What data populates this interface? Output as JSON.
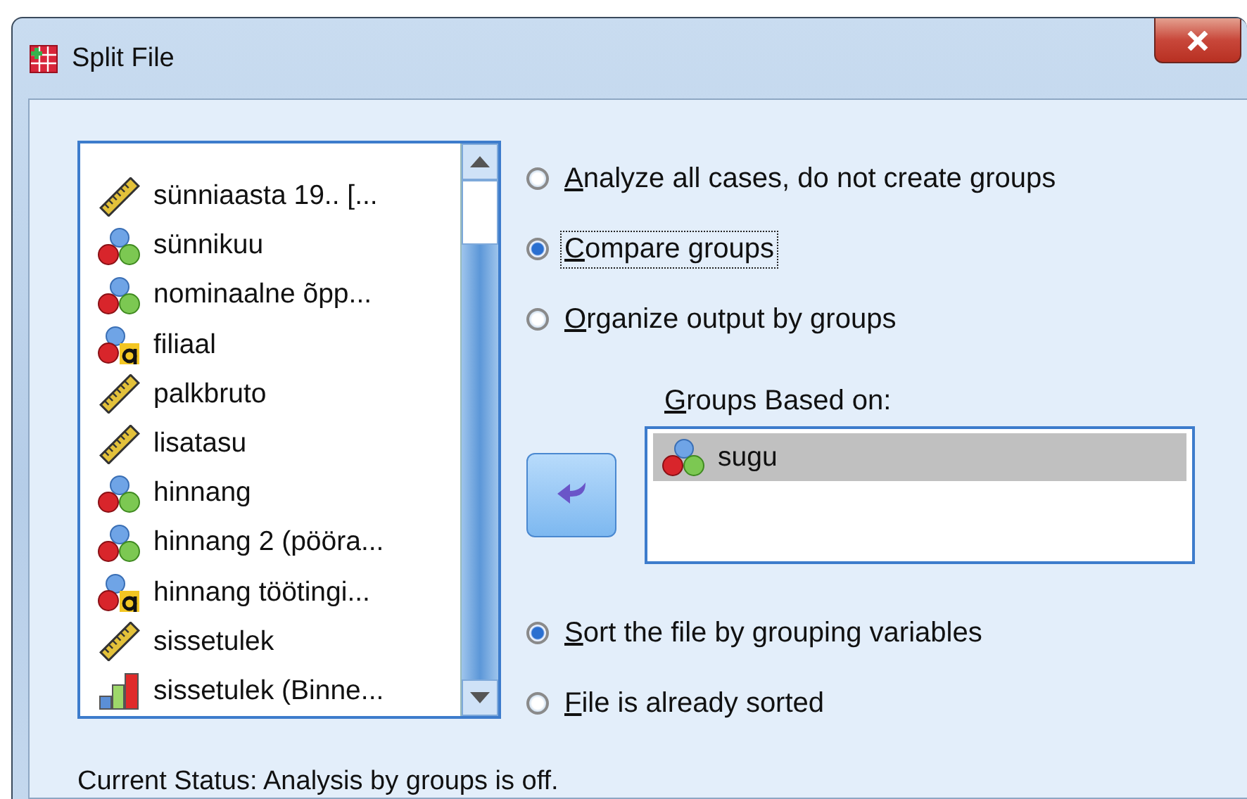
{
  "window": {
    "title": "Split File"
  },
  "variables": [
    {
      "name": "sünniaasta 19.. [...",
      "kind": "scale"
    },
    {
      "name": "sünnikuu",
      "kind": "nominal"
    },
    {
      "name": "nominaalne õpp...",
      "kind": "nominal"
    },
    {
      "name": "filiaal",
      "kind": "string"
    },
    {
      "name": "palkbruto",
      "kind": "scale"
    },
    {
      "name": "lisatasu",
      "kind": "scale"
    },
    {
      "name": "hinnang",
      "kind": "nominal"
    },
    {
      "name": "hinnang 2 (pööra...",
      "kind": "nominal"
    },
    {
      "name": "hinnang töötingi...",
      "kind": "string"
    },
    {
      "name": "sissetulek",
      "kind": "scale"
    },
    {
      "name": "sissetulek (Binne...",
      "kind": "ordinal"
    }
  ],
  "mode_options": [
    {
      "label": "Analyze all cases, do not create groups",
      "selected": false
    },
    {
      "label": "Compare groups",
      "selected": true,
      "focused": true
    },
    {
      "label": "Organize output by groups",
      "selected": false
    }
  ],
  "groups_based_on": {
    "label": "Groups Based on:",
    "items": [
      {
        "name": "sugu",
        "kind": "nominal",
        "selected": true
      }
    ]
  },
  "sort_options": [
    {
      "label": "Sort the file by grouping variables",
      "selected": true
    },
    {
      "label": "File is already sorted",
      "selected": false
    }
  ],
  "status": "Current Status: Analysis by groups is off."
}
